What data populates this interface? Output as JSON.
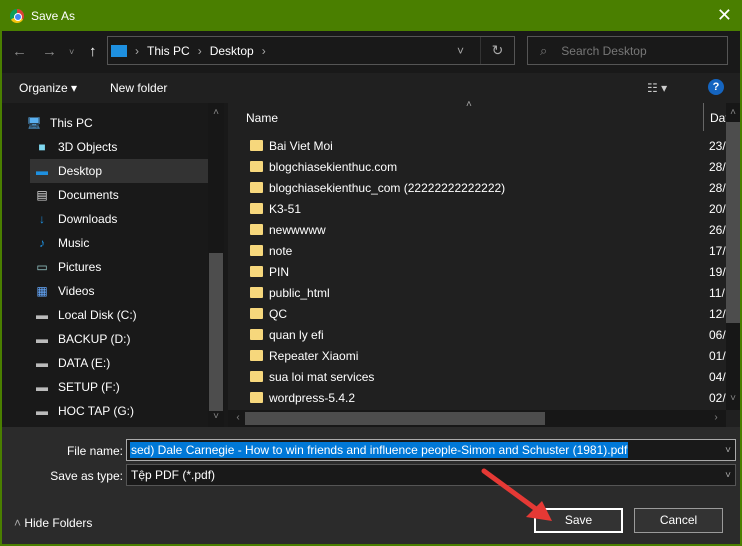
{
  "window": {
    "title": "Save As",
    "accent": "#4a7f00"
  },
  "nav": {
    "breadcrumb": [
      "This PC",
      "Desktop"
    ],
    "search_placeholder": "Search Desktop"
  },
  "toolbar": {
    "organize": "Organize ▾",
    "new_folder": "New folder",
    "help": "?"
  },
  "sidebar": {
    "items": [
      {
        "label": "This PC",
        "icon": "computer-icon"
      },
      {
        "label": "3D Objects",
        "icon": "cube-icon"
      },
      {
        "label": "Desktop",
        "icon": "desktop-icon",
        "selected": true
      },
      {
        "label": "Documents",
        "icon": "document-icon"
      },
      {
        "label": "Downloads",
        "icon": "download-icon"
      },
      {
        "label": "Music",
        "icon": "music-icon"
      },
      {
        "label": "Pictures",
        "icon": "picture-icon"
      },
      {
        "label": "Videos",
        "icon": "video-icon"
      },
      {
        "label": "Local Disk (C:)",
        "icon": "drive-icon"
      },
      {
        "label": "BACKUP (D:)",
        "icon": "drive-icon"
      },
      {
        "label": "DATA (E:)",
        "icon": "drive-icon"
      },
      {
        "label": "SETUP (F:)",
        "icon": "drive-icon"
      },
      {
        "label": "HOC TAP (G:)",
        "icon": "drive-icon"
      }
    ]
  },
  "list": {
    "columns": {
      "name": "Name",
      "date": "Dat"
    },
    "rows": [
      {
        "name": "Bai Viet Moi",
        "date": "23/"
      },
      {
        "name": "blogchiasekienthuc.com",
        "date": "28/"
      },
      {
        "name": "blogchiasekienthuc_com (22222222222222)",
        "date": "28/"
      },
      {
        "name": "K3-51",
        "date": "20/"
      },
      {
        "name": "newwwww",
        "date": "26/"
      },
      {
        "name": "note",
        "date": "17/"
      },
      {
        "name": "PIN",
        "date": "19/"
      },
      {
        "name": "public_html",
        "date": "11/"
      },
      {
        "name": "QC",
        "date": "12/"
      },
      {
        "name": "quan ly efi",
        "date": "06/"
      },
      {
        "name": "Repeater Xiaomi",
        "date": "01/"
      },
      {
        "name": "sua loi mat services",
        "date": "04/"
      },
      {
        "name": "wordpress-5.4.2",
        "date": "02/"
      }
    ]
  },
  "form": {
    "file_name_label": "File name:",
    "file_name": "sed) Dale Carnegie - How to win friends and influence people-Simon and Schuster (1981).pdf",
    "type_label": "Save as type:",
    "type": "Tệp PDF (*.pdf)"
  },
  "buttons": {
    "save": "Save",
    "cancel": "Cancel",
    "hide_folders": "Hide Folders"
  }
}
